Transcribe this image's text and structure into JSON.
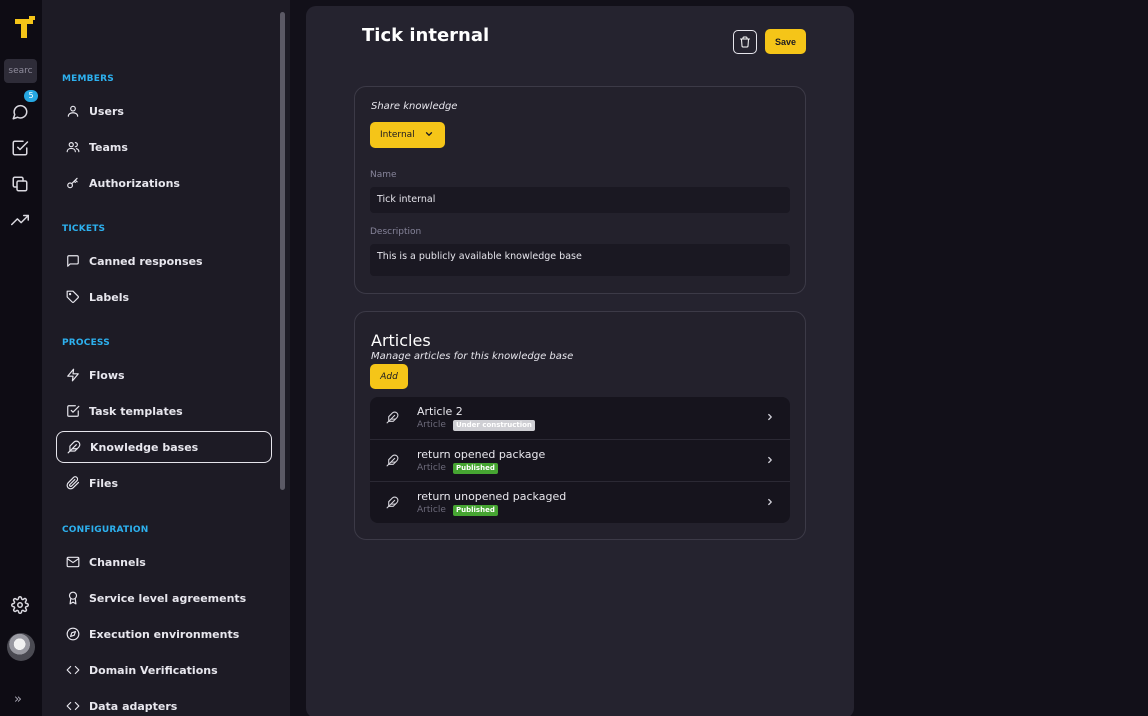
{
  "rail": {
    "search_placeholder": "searc",
    "chat_badge": "5"
  },
  "sidebar": {
    "sections": {
      "members": "MEMBERS",
      "tickets": "TICKETS",
      "process": "PROCESS",
      "configuration": "CONFIGURATION"
    },
    "items": {
      "users": "Users",
      "teams": "Teams",
      "authorizations": "Authorizations",
      "canned": "Canned responses",
      "labels": "Labels",
      "flows": "Flows",
      "task_templates": "Task templates",
      "knowledge_bases": "Knowledge bases",
      "files": "Files",
      "channels": "Channels",
      "sla": "Service level agreements",
      "exec_env": "Execution environments",
      "domain_verif": "Domain Verifications",
      "data_adapters": "Data adapters"
    }
  },
  "page": {
    "title": "Tick internal",
    "save_label": "Save"
  },
  "form": {
    "share_label": "Share knowledge",
    "share_value": "Internal",
    "name_label": "Name",
    "name_value": "Tick internal",
    "description_label": "Description",
    "description_value": "This is a publicly available knowledge base"
  },
  "articles": {
    "title": "Articles",
    "subtitle": "Manage articles for this knowledge base",
    "add_label": "Add",
    "items": [
      {
        "title": "Article 2",
        "type": "Article",
        "status": "Under construction"
      },
      {
        "title": "return opened package",
        "type": "Article",
        "status": "Published"
      },
      {
        "title": "return unopened packaged",
        "type": "Article",
        "status": "Published"
      }
    ]
  },
  "colors": {
    "accent": "#f5c518",
    "section": "#2db1ef",
    "published": "#46a532",
    "construction": "#cfcfd4"
  }
}
